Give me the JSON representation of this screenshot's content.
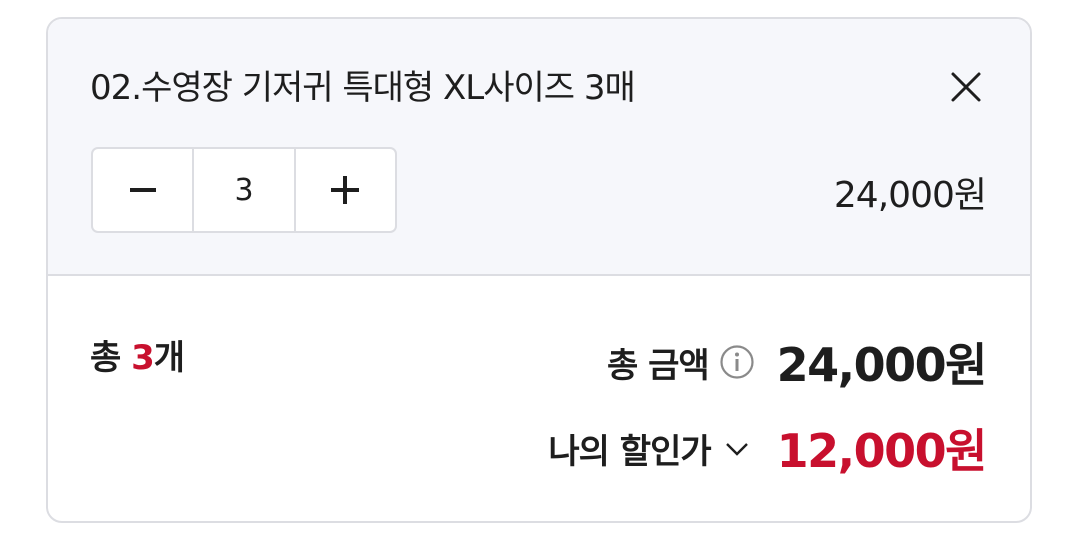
{
  "option": {
    "name": "02.수영장 기저귀 특대형 XL사이즈 3매",
    "quantity": "3",
    "price": "24,000원"
  },
  "summary": {
    "count_prefix": "총 ",
    "count_value": "3",
    "count_suffix": "개",
    "total_label": "총 금액",
    "total_amount": "24,000원",
    "discount_label": "나의 할인가",
    "discount_amount": "12,000원"
  },
  "icons": {
    "close": "close-icon",
    "minus": "minus-icon",
    "plus": "plus-icon",
    "info": "info-icon",
    "chevron": "chevron-down-icon"
  },
  "colors": {
    "accent_red": "#c8102e",
    "panel_bg": "#f6f7fb",
    "border": "#dcdde2"
  }
}
